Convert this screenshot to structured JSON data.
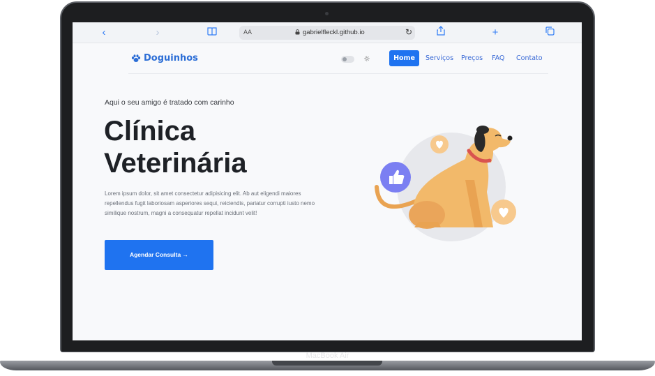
{
  "device": {
    "brand_label": "MacBook Air"
  },
  "browser": {
    "text_size_label": "AA",
    "url": "gabrielfleckl.github.io",
    "icons": [
      "back-icon",
      "forward-icon",
      "book-icon",
      "lock-icon",
      "reload-icon",
      "share-icon",
      "plus-icon",
      "tabs-icon"
    ]
  },
  "site": {
    "logo_text": "Doguinhos",
    "nav": {
      "home": "Home",
      "servicos": "Serviços",
      "precos": "Preços",
      "faq": "FAQ",
      "contato": "Contato"
    },
    "hero": {
      "tagline": "Aqui o seu amigo é tratado com carinho",
      "title_line1": "Clínica",
      "title_line2": "Veterinária",
      "text": "Lorem ipsum dolor, sit amet consectetur adipisicing elit. Ab aut eligendi maiores repellendus fugit laboriosam asperiores sequi, reiciendis, pariatur corrupti iusto nemo similique nostrum, magni a consequatur repellat incidunt velit!",
      "cta_label": "Agendar Consulta →"
    }
  },
  "colors": {
    "accent": "#1f73f0",
    "logo": "#2c6ed6",
    "dog": "#f2b96a",
    "badge_orange": "#f7c98d",
    "badge_purple": "#7b7ff2"
  }
}
